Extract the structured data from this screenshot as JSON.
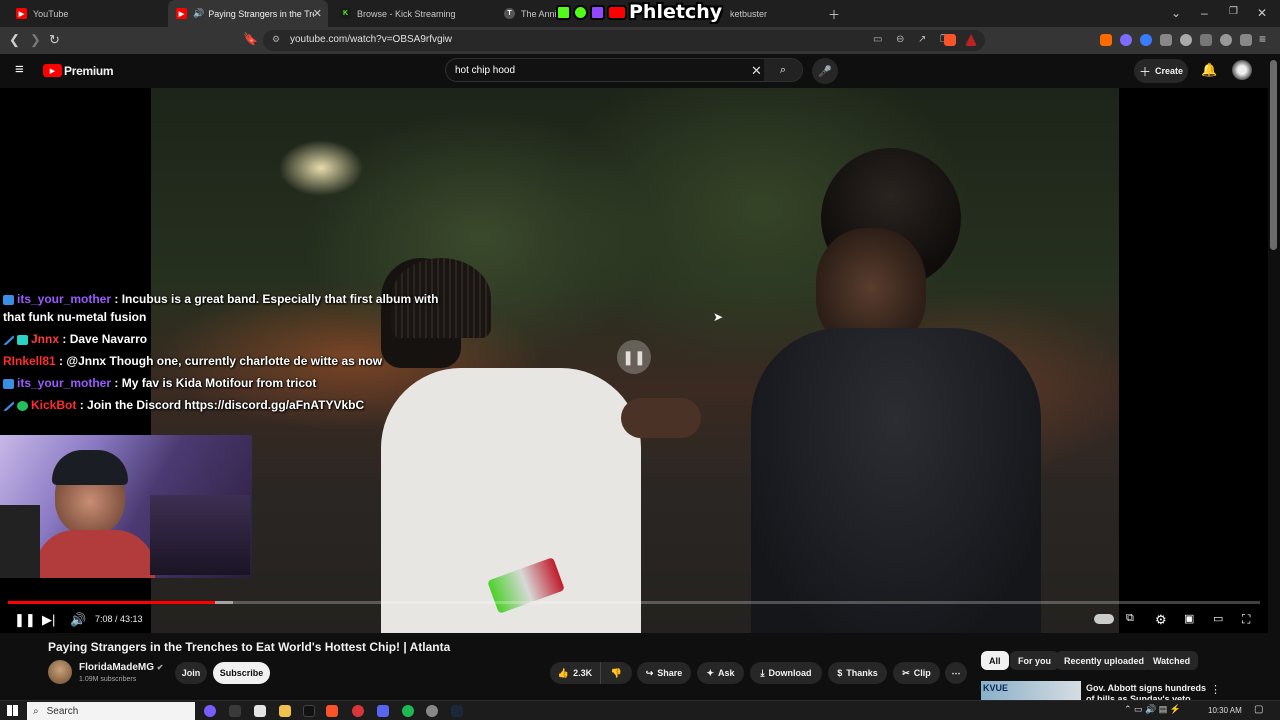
{
  "browser": {
    "tabs": [
      {
        "label": "YouTube"
      },
      {
        "label": "Paying Strangers in the Trench"
      },
      {
        "label": "Browse - Kick Streaming"
      },
      {
        "label": "The Annie"
      },
      {
        "label": "ketbuster"
      }
    ],
    "overlay_logo_text": "Phletchy",
    "url": "youtube.com/watch?v=OBSA9rfvgiw"
  },
  "youtube": {
    "logo_label": "Premium",
    "search_query": "hot chip hood",
    "create_label": "Create"
  },
  "chat": [
    {
      "user": "its_your_mother",
      "user_color": "#9b59ff",
      "message": ": Incubus is a great band. Especially that first album with",
      "message2": "that funk nu-metal fusion"
    },
    {
      "user": "Jnnx",
      "user_color": "#ff3b3b",
      "message": ": Dave Navarro"
    },
    {
      "user": "RInkell81",
      "user_color": "#ff2d2d",
      "message": ": @Jnnx Though one, currently charlotte de witte as now"
    },
    {
      "user": "its_your_mother",
      "user_color": "#9b59ff",
      "message": ": My fav is Kida Motifour from tricot"
    },
    {
      "user": "KickBot",
      "user_color": "#ff2d2d",
      "message": ": Join the Discord https://discord.gg/aFnATYVkbC"
    }
  ],
  "player": {
    "time": "7:08 / 43:13",
    "progress": 0.165,
    "buffered": 0.18
  },
  "video": {
    "title": "Paying Strangers in the Trenches to Eat World's Hottest Chip! | Atlanta",
    "channel": "FloridaMadeMG",
    "subscribers": "1.09M subscribers",
    "join_label": "Join",
    "subscribe_label": "Subscribe",
    "likes": "2.3K",
    "share_label": "Share",
    "ask_label": "Ask",
    "download_label": "Download",
    "thanks_label": "Thanks",
    "clip_label": "Clip"
  },
  "filters": [
    "All",
    "For you",
    "Recently uploaded",
    "Watched"
  ],
  "recommendation": {
    "thumb_text": "KVUE",
    "title": "Gov. Abbott signs hundreds of bills as Sunday's veto deadline"
  },
  "taskbar": {
    "search_placeholder": "Search",
    "clock": "10:30 AM"
  },
  "colors": {
    "youtube_red": "#ff0000",
    "kick_green": "#53fc18"
  }
}
